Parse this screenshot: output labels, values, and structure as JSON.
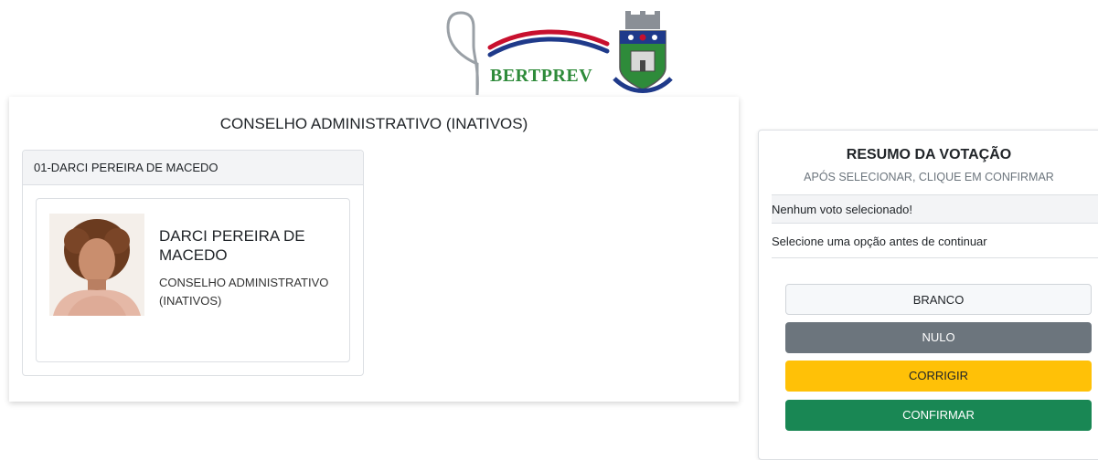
{
  "logo": {
    "text": "BERTPREV",
    "icons": [
      "bertprev-logo",
      "city-coat-of-arms"
    ]
  },
  "ballot": {
    "title": "CONSELHO ADMINISTRATIVO (INATIVOS)",
    "candidates": [
      {
        "header": "01-DARCI PEREIRA DE MACEDO",
        "name": "DARCI PEREIRA DE MACEDO",
        "role": "CONSELHO ADMINISTRATIVO (INATIVOS)"
      }
    ]
  },
  "summary": {
    "title": "RESUMO DA VOTAÇÃO",
    "subtitle": "APÓS SELECIONAR, CLIQUE EM CONFIRMAR",
    "empty_message": "Nenhum voto selecionado!",
    "help_message": "Selecione uma opção antes de continuar",
    "buttons": {
      "branco": "BRANCO",
      "nulo": "NULO",
      "corrigir": "CORRIGIR",
      "confirmar": "CONFIRMAR"
    }
  },
  "colors": {
    "nulo": "#6c757d",
    "corrigir": "#ffc107",
    "confirmar": "#198754",
    "logo_green": "#2e8b3a",
    "logo_red": "#c8102e",
    "logo_blue": "#1f3a8a"
  }
}
